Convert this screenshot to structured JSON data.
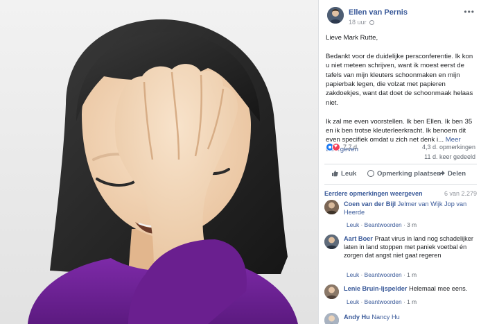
{
  "post": {
    "author": "Ellen van Pernis",
    "time": "18 uur",
    "more_icon": "ellipsis-icon",
    "paragraphs": [
      "Lieve Mark Rutte,",
      "Bedankt voor de duidelijke persconferentie. Ik kon u niet meteen schrijven, want ik moest eerst de tafels van mijn kleuters schoonmaken en mijn papierbak legen, die volzat met papieren zakdoekjes, want dat doet de schoonmaak helaas niet.",
      "Ik zal me even voorstellen. Ik ben Ellen. Ik ben 35 en ik ben trotse kleuterleerkracht. Ik benoem dit even specifiek omdat u zich net denk i..."
    ],
    "see_more": "Meer weergeven"
  },
  "stats": {
    "reactions": "7,7 d.",
    "comments": "4,3 d. opmerkingen",
    "shares": "11 d. keer gedeeld"
  },
  "actions": {
    "like": "Leuk",
    "comment": "Opmerking plaatsen",
    "share": "Delen"
  },
  "comments_section": {
    "previous_link": "Eerdere opmerkingen weergeven",
    "count": "6 van 2.279",
    "items": [
      {
        "name": "Coen van der Bijl",
        "tags": "Jelmer van Wijk Jop van Heerde",
        "text": "",
        "like": "Leuk",
        "reply": "Beantwoorden",
        "time": "3 m"
      },
      {
        "name": "Aart Boer",
        "tags": "",
        "text": "Praat virus in land nog schadelijker laten in land stoppen met paniek voetbal én zorgen dat angst niet gaat regeren",
        "like": "Leuk",
        "reply": "Beantwoorden",
        "time": "1 m"
      },
      {
        "name": "Lenie Bruin-Ijspelder",
        "tags": "",
        "text": "Helemaal mee eens.",
        "like": "Leuk",
        "reply": "Beantwoorden",
        "time": "1 m"
      },
      {
        "name": "Andy Hu",
        "tags": "Nancy Hu",
        "text": "",
        "like": "",
        "reply": "",
        "time": ""
      }
    ]
  },
  "colors": {
    "link": "#385898",
    "like_reaction": "#1877f2",
    "love_reaction": "#f33e58",
    "hair": "#2b2b2b",
    "skin": "#f2d3b3",
    "shirt": "#6a1f8f"
  }
}
